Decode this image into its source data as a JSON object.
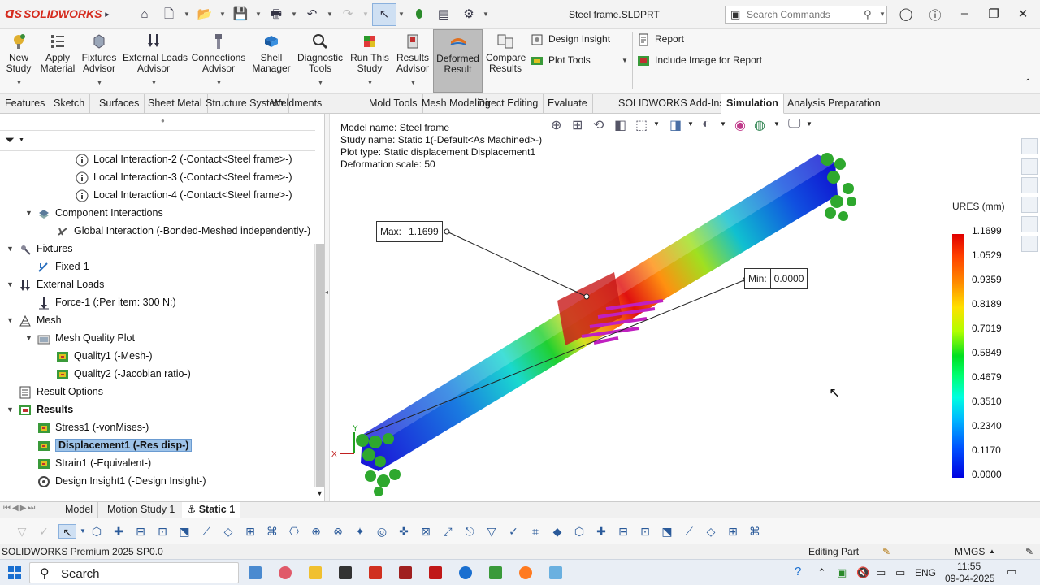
{
  "app": {
    "brand": "SOLIDWORKS",
    "window_title": "Steel frame.SLDPRT",
    "search_placeholder": "Search Commands"
  },
  "ribbon": {
    "buttons": [
      {
        "id": "new-study",
        "label": "New\nStudy"
      },
      {
        "id": "apply-material",
        "label": "Apply\nMaterial"
      },
      {
        "id": "fixtures-advisor",
        "label": "Fixtures\nAdvisor"
      },
      {
        "id": "external-loads-advisor",
        "label": "External Loads\nAdvisor"
      },
      {
        "id": "connections-advisor",
        "label": "Connections\nAdvisor"
      },
      {
        "id": "shell-manager",
        "label": "Shell\nManager"
      },
      {
        "id": "diagnostic-tools",
        "label": "Diagnostic\nTools"
      },
      {
        "id": "run-this-study",
        "label": "Run This\nStudy"
      },
      {
        "id": "results-advisor",
        "label": "Results\nAdvisor"
      },
      {
        "id": "deformed-result",
        "label": "Deformed\nResult"
      },
      {
        "id": "compare-results",
        "label": "Compare\nResults"
      }
    ],
    "design_insight": "Design Insight",
    "plot_tools": "Plot Tools",
    "report": "Report",
    "include_image": "Include Image for Report"
  },
  "tabs": [
    "Features",
    "Sketch",
    "Surfaces",
    "Sheet Metal",
    "Structure System",
    "Weldments",
    "Mold Tools",
    "Mesh Modeling",
    "Direct Editing",
    "Evaluate",
    "SOLIDWORKS Add-Ins",
    "Simulation",
    "Analysis Preparation"
  ],
  "active_tab": "Simulation",
  "tree": {
    "items": [
      {
        "label": "Local Interaction-2 (-Contact<Steel frame>-)"
      },
      {
        "label": "Local Interaction-3 (-Contact<Steel frame>-)"
      },
      {
        "label": "Local Interaction-4 (-Contact<Steel frame>-)"
      },
      {
        "label": "Component Interactions"
      },
      {
        "label": "Global Interaction (-Bonded-Meshed independently-)"
      },
      {
        "label": "Fixtures"
      },
      {
        "label": "Fixed-1"
      },
      {
        "label": "External Loads"
      },
      {
        "label": "Force-1 (:Per item: 300 N:)"
      },
      {
        "label": "Mesh"
      },
      {
        "label": "Mesh Quality Plot"
      },
      {
        "label": "Quality1 (-Mesh-)"
      },
      {
        "label": "Quality2 (-Jacobian ratio-)"
      },
      {
        "label": "Result Options"
      },
      {
        "label": "Results"
      },
      {
        "label": "Stress1 (-vonMises-)"
      },
      {
        "label": "Displacement1 (-Res disp-)"
      },
      {
        "label": "Strain1 (-Equivalent-)"
      },
      {
        "label": "Design Insight1 (-Design Insight-)"
      }
    ]
  },
  "viewport": {
    "model_name": "Model name: Steel frame",
    "study_name": "Study name: Static 1(-Default<As Machined>-)",
    "plot_type": "Plot type: Static displacement Displacement1",
    "deformation": "Deformation scale: 50",
    "max_label": "Max:",
    "max_value": "1.1699",
    "min_label": "Min:",
    "min_value": "0.0000",
    "legend_title": "URES (mm)",
    "legend_values": [
      "1.1699",
      "1.0529",
      "0.9359",
      "0.8189",
      "0.7019",
      "0.5849",
      "0.4679",
      "0.3510",
      "0.2340",
      "0.1170",
      "0.0000"
    ],
    "axis_y": "Y",
    "axis_x": "X"
  },
  "bottom_tabs": [
    "Model",
    "Motion Study 1",
    "Static 1"
  ],
  "status": {
    "left": "SOLIDWORKS Premium 2025 SP0.0",
    "mode": "Editing Part",
    "units": "MMGS"
  },
  "taskbar": {
    "search": "Search",
    "lang": "ENG",
    "time": "11:55",
    "date": "09-04-2025"
  }
}
